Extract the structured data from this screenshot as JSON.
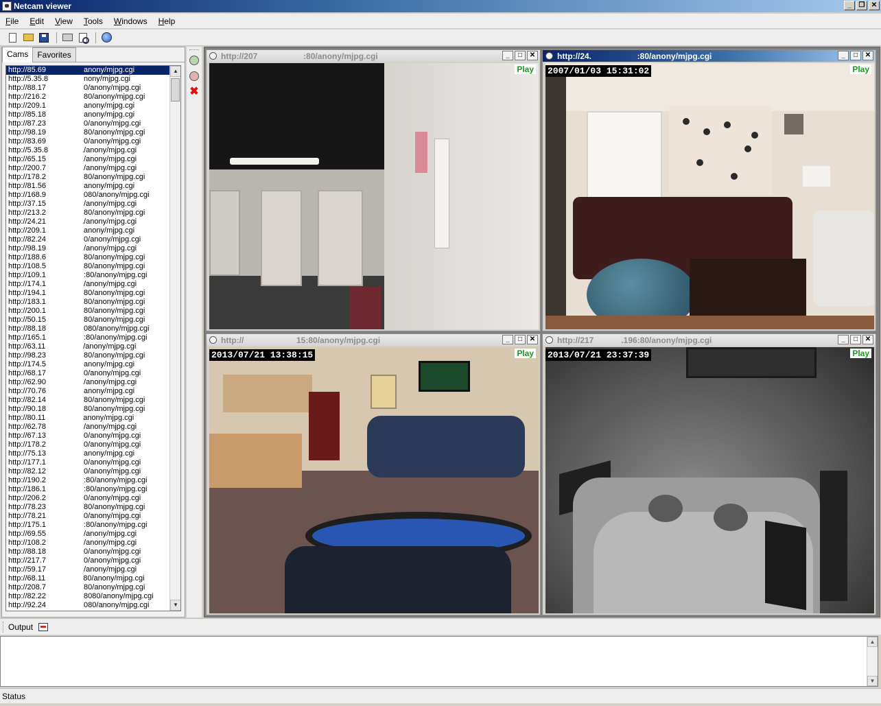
{
  "window": {
    "title": "Netcam viewer"
  },
  "menu": [
    "File",
    "Edit",
    "View",
    "Tools",
    "Windows",
    "Help"
  ],
  "menu_underline": [
    "F",
    "E",
    "V",
    "T",
    "W",
    "H"
  ],
  "toolbar_icons": [
    "new-icon",
    "open-icon",
    "save-icon",
    "print-icon",
    "print-preview-icon",
    "web-icon"
  ],
  "left_tabs": {
    "cams": "Cams",
    "favorites": "Favorites"
  },
  "cams": [
    "http://85.69                  anony/mjpg.cgi",
    "http://5.35.8                 nony/mjpg.cgi",
    "http://88.17                  0/anony/mjpg.cgi",
    "http://216.2                  80/anony/mjpg.cgi",
    "http://209.1                  anony/mjpg.cgi",
    "http://85.18                  anony/mjpg.cgi",
    "http://87.23                  0/anony/mjpg.cgi",
    "http://98.19                  80/anony/mjpg.cgi",
    "http://83.69                  0/anony/mjpg.cgi",
    "http://5.35.8                 /anony/mjpg.cgi",
    "http://65.15                  /anony/mjpg.cgi",
    "http://200.7                  /anony/mjpg.cgi",
    "http://178.2                  80/anony/mjpg.cgi",
    "http://81.56                  anony/mjpg.cgi",
    "http://168.9                  080/anony/mjpg.cgi",
    "http://37.15                  /anony/mjpg.cgi",
    "http://213.2                  80/anony/mjpg.cgi",
    "http://24.21                  /anony/mjpg.cgi",
    "http://209.1                  anony/mjpg.cgi",
    "http://82.24                  0/anony/mjpg.cgi",
    "http://98.19                  /anony/mjpg.cgi",
    "http://188.6                  80/anony/mjpg.cgi",
    "http://108.5                  80/anony/mjpg.cgi",
    "http://109.1                  :80/anony/mjpg.cgi",
    "http://174.1                  /anony/mjpg.cgi",
    "http://194.1                  80/anony/mjpg.cgi",
    "http://183.1                  80/anony/mjpg.cgi",
    "http://200.1                  80/anony/mjpg.cgi",
    "http://50.15                  80/anony/mjpg.cgi",
    "http://88.18                  080/anony/mjpg.cgi",
    "http://165.1                  :80/anony/mjpg.cgi",
    "http://63.11                  /anony/mjpg.cgi",
    "http://98.23                  80/anony/mjpg.cgi",
    "http://174.5                  anony/mjpg.cgi",
    "http://68.17                  0/anony/mjpg.cgi",
    "http://62.90                  /anony/mjpg.cgi",
    "http://70.76                  anony/mjpg.cgi",
    "http://82.14                  80/anony/mjpg.cgi",
    "http://90.18                  80/anony/mjpg.cgi",
    "http://80.11                  anony/mjpg.cgi",
    "http://62.78                  /anony/mjpg.cgi",
    "http://67.13                  0/anony/mjpg.cgi",
    "http://178.2                  0/anony/mjpg.cgi",
    "http://75.13                  anony/mjpg.cgi",
    "http://177.1                  0/anony/mjpg.cgi",
    "http://82.12                  0/anony/mjpg.cgi",
    "http://190.2                  :80/anony/mjpg.cgi",
    "http://186.1                  :80/anony/mjpg.cgi",
    "http://206.2                  0/anony/mjpg.cgi",
    "http://78.23                  80/anony/mjpg.cgi",
    "http://78.21                  0/anony/mjpg.cgi",
    "http://175.1                  :80/anony/mjpg.cgi",
    "http://69.55                  /anony/mjpg.cgi",
    "http://108.2                  /anony/mjpg.cgi",
    "http://88.18                  0/anony/mjpg.cgi",
    "http://217.7                  0/anony/mjpg.cgi",
    "http://59.17                  /anony/mjpg.cgi",
    "http://68.11                  80/anony/mjpg.cgi",
    "http://208.7                  80/anony/mjpg.cgi",
    "http://82.22                  8080/anony/mjpg.cgi",
    "http://92.24                  080/anony/mjpg.cgi"
  ],
  "cam_windows": [
    {
      "url": "http://207                    :80/anony/mjpg.cgi",
      "status": "Play",
      "timestamp": ""
    },
    {
      "url": "http://24.                    :80/anony/mjpg.cgi",
      "status": "Play",
      "timestamp": "2007/01/03 15:31:02"
    },
    {
      "url": "http://                       15:80/anony/mjpg.cgi",
      "status": "Play",
      "timestamp": "2013/07/21 13:38:15"
    },
    {
      "url": "http://217            .196:80/anony/mjpg.cgi",
      "status": "Play",
      "timestamp": "2013/07/21 23:37:39"
    }
  ],
  "output": {
    "label": "Output"
  },
  "status": {
    "label": "Status"
  }
}
